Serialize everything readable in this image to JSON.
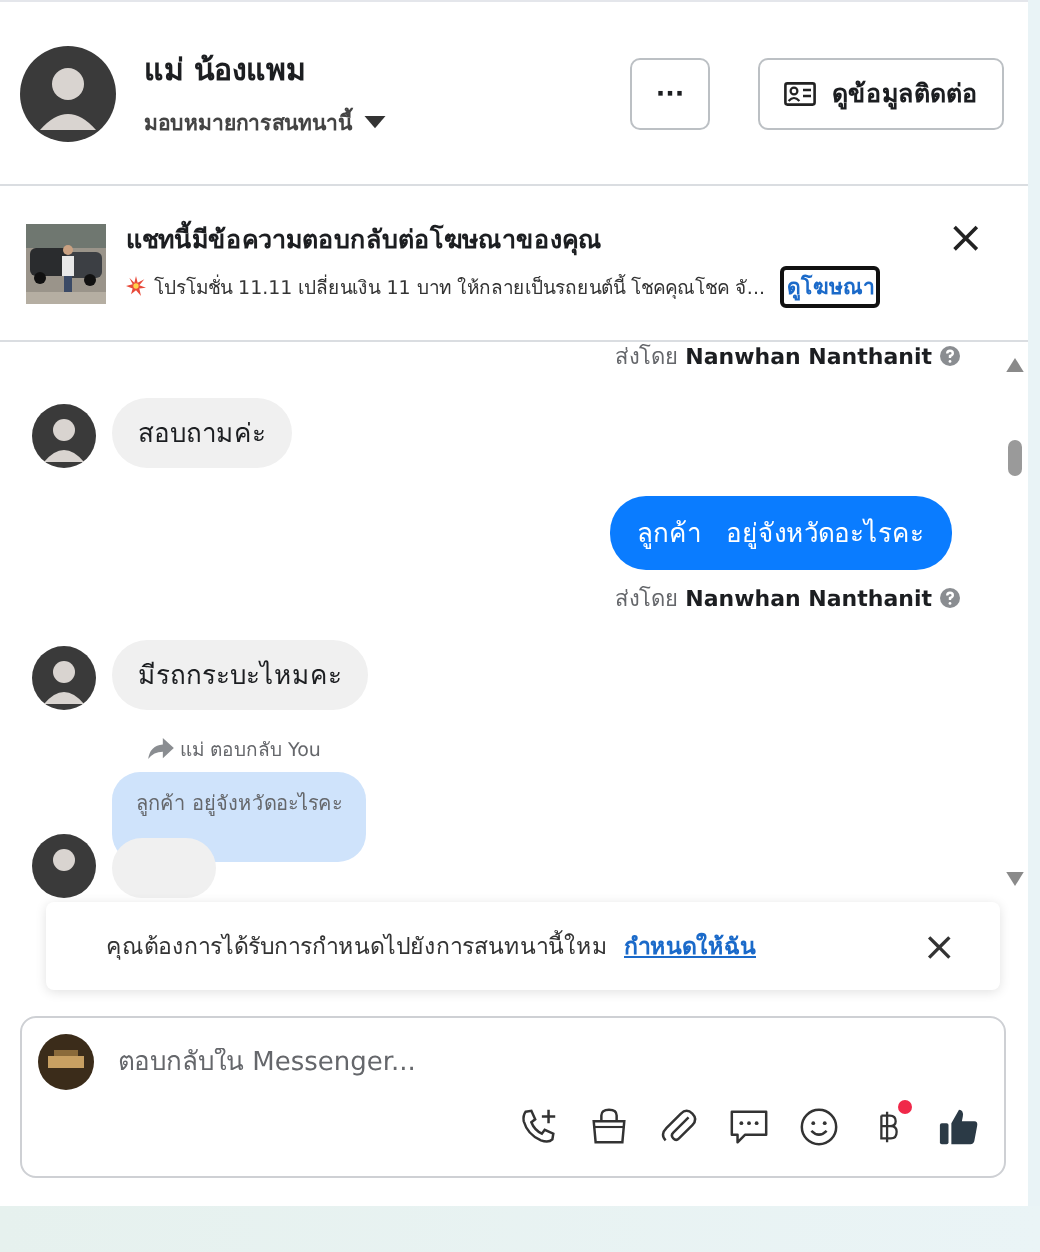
{
  "header": {
    "name": "แม่ น้องแพม",
    "assign_label": "มอบหมายการสนทนานี้",
    "more_button": "···",
    "contact_button": "ดูข้อมูลติดต่อ"
  },
  "ad": {
    "title": "แชทนี้มีข้อความตอบกลับต่อโฆษณาของคุณ",
    "text": "โปรโมชั่น 11.11 เปลี่ยนเงิน 11 บาท ให้กลายเป็นรถยนต์นี้ โชคคุณโชค จั...",
    "link": "ดูโฆษณา",
    "close": "×"
  },
  "messages": [
    {
      "kind": "sender_note",
      "prefix": "ส่งโดย",
      "name": "Nanwhan Nanthanit"
    },
    {
      "kind": "incoming",
      "text": "สอบถามค่ะ"
    },
    {
      "kind": "outgoing",
      "text": "ลูกค้า   อยู่จังหวัดอะไรคะ"
    },
    {
      "kind": "sender_note",
      "prefix": "ส่งโดย",
      "name": "Nanwhan Nanthanit"
    },
    {
      "kind": "incoming",
      "text": "มีรถกระบะไหมคะ"
    },
    {
      "kind": "reply_note",
      "text": "แม่ ตอบกลับ You"
    },
    {
      "kind": "quoted",
      "text": "ลูกค้า อยู่จังหวัดอะไรคะ"
    },
    {
      "kind": "incoming_hidden"
    }
  ],
  "notice": {
    "text": "คุณต้องการได้รับการกำหนดไปยังการสนทนานี้ใหม",
    "link": "กำหนดให้ฉัน",
    "close": "×"
  },
  "composer": {
    "placeholder": "ตอบกลับใน Messenger...",
    "payment_badge": true
  }
}
